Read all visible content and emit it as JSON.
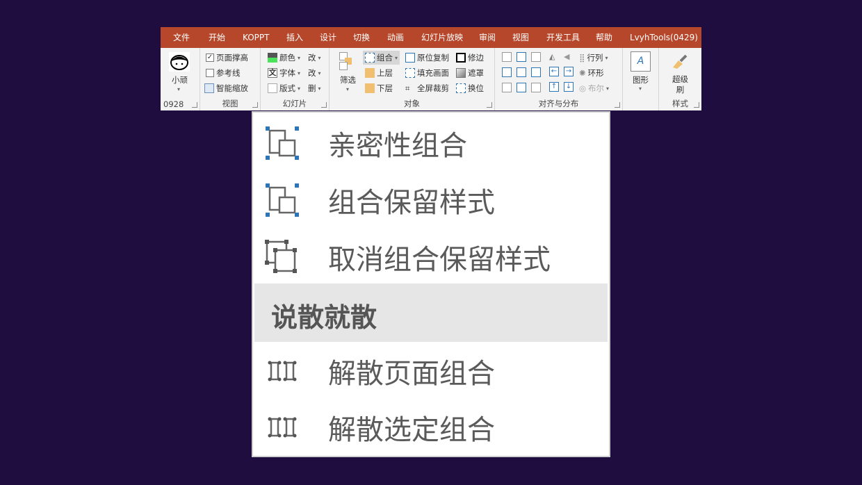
{
  "tabs": [
    "文件",
    "开始",
    "KOPPT",
    "插入",
    "设计",
    "切换",
    "动画",
    "幻灯片放映",
    "审阅",
    "视图",
    "开发工具",
    "帮助",
    "LvyhTools(0429)"
  ],
  "groups": {
    "user": {
      "name": "小顽",
      "label": "0928"
    },
    "view": {
      "label": "视图",
      "items": [
        "页面撑高",
        "参考线",
        "智能缩放"
      ]
    },
    "slide": {
      "label": "幻灯片",
      "items": [
        "颜色",
        "字体",
        "版式"
      ],
      "extra": [
        "改",
        "改",
        "删"
      ]
    },
    "object": {
      "label": "对象",
      "filter": "筛选",
      "items": [
        "组合",
        "上层",
        "下层",
        "原位复制",
        "填充画面",
        "全屏裁剪",
        "修边",
        "遮罩",
        "换位"
      ]
    },
    "align": {
      "label": "对齐与分布",
      "items": [
        "行列",
        "环形",
        "布尔"
      ]
    },
    "shape": {
      "label": "图形"
    },
    "style": {
      "label": "样式",
      "brush": "超级刷"
    }
  },
  "menu": {
    "items": [
      "亲密性组合",
      "组合保留样式",
      "取消组合保留样式"
    ],
    "section": "说散就散",
    "items2": [
      "解散页面组合",
      "解散选定组合"
    ]
  },
  "colors": {
    "tabbar": "#b7472a",
    "background": "#200d3f",
    "accent": "#2e75b6"
  }
}
